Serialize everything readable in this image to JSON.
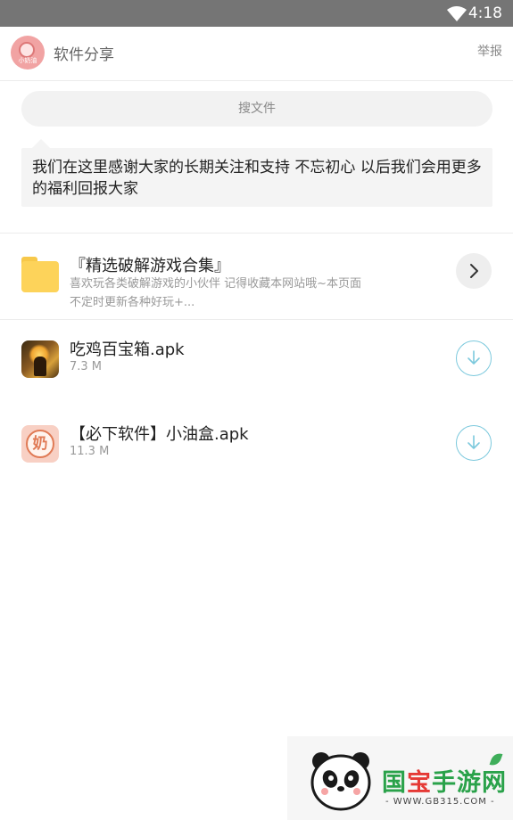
{
  "status_bar": {
    "time": "4:18"
  },
  "header": {
    "avatar_text": "小奶油",
    "title": "软件分享",
    "report_label": "举报"
  },
  "search": {
    "placeholder": "搜文件"
  },
  "notice": {
    "text": "我们在这里感谢大家的长期关注和支持 不忘初心 以后我们会用更多的福利回报大家"
  },
  "folder": {
    "name": "『精选破解游戏合集』",
    "description": "喜欢玩各类破解游戏的小伙伴 记得收藏本网站哦~本页面不定时更新各种好玩+..."
  },
  "files": [
    {
      "name": "吃鸡百宝箱.apk",
      "size": "7.3 M",
      "icon": "game-app-icon"
    },
    {
      "name": "【必下软件】小油盒.apk",
      "size": "11.3 M",
      "icon": "oil-box-app-icon",
      "icon_glyph": "奶"
    }
  ],
  "watermark": {
    "part1": "国",
    "part2": "宝",
    "part3": "手游网",
    "url": "- WWW.GB315.COM -"
  },
  "colors": {
    "status_bar": "#757575",
    "folder": "#fdd35a",
    "download_ring": "#7cc9dd",
    "brand_green": "#2aa24a",
    "brand_red": "#e53935"
  }
}
